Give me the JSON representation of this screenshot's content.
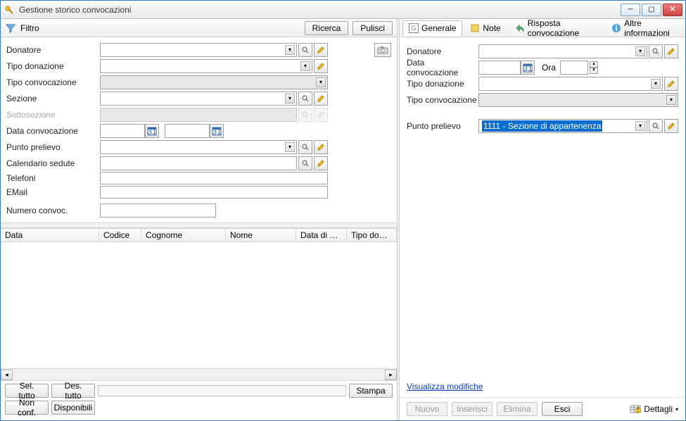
{
  "window": {
    "title": "Gestione storico convocazioni"
  },
  "filter": {
    "label": "Filtro",
    "ricerca": "Ricerca",
    "pulisci": "Pulisci",
    "fields": {
      "donatore": "Donatore",
      "tipo_donazione": "Tipo donazione",
      "tipo_convocazione": "Tipo convocazione",
      "sezione": "Sezione",
      "sottosezione": "Sottosezione",
      "data_convocazione": "Data convocazione",
      "punto_prelievo": "Punto prelievo",
      "calendario_sedute": "Calendario sedute",
      "telefoni": "Telefoni",
      "email": "EMail",
      "numero_convoc": "Numero convoc."
    }
  },
  "grid": {
    "columns": [
      "Data",
      "Codice",
      "Cognome",
      "Nome",
      "Data di na...",
      "Tipo donazione"
    ]
  },
  "leftbottom": {
    "sel_tutto": "Sel. tutto",
    "des_tutto": "Des. tutto",
    "stampa": "Stampa",
    "non_conf": "Non conf.",
    "disponibili": "Disponibili"
  },
  "tabs": {
    "generale": "Generale",
    "note": "Note",
    "risposta": "Risposta convocazione",
    "altre": "Altre informazioni"
  },
  "detail": {
    "donatore": "Donatore",
    "data_convocazione": "Data convocazione",
    "ora": "Ora",
    "tipo_donazione": "Tipo donazione",
    "tipo_convocazione": "Tipo convocazione",
    "punto_prelievo": "Punto prelievo",
    "punto_prelievo_value": "1111 -  Sezione di appartenenza"
  },
  "footer": {
    "visualizza": "Visualizza modifiche",
    "nuovo": "Nuovo",
    "inserisci": "Inserisci",
    "elimina": "Elimina",
    "esci": "Esci",
    "dettagli": "Dettagli"
  }
}
